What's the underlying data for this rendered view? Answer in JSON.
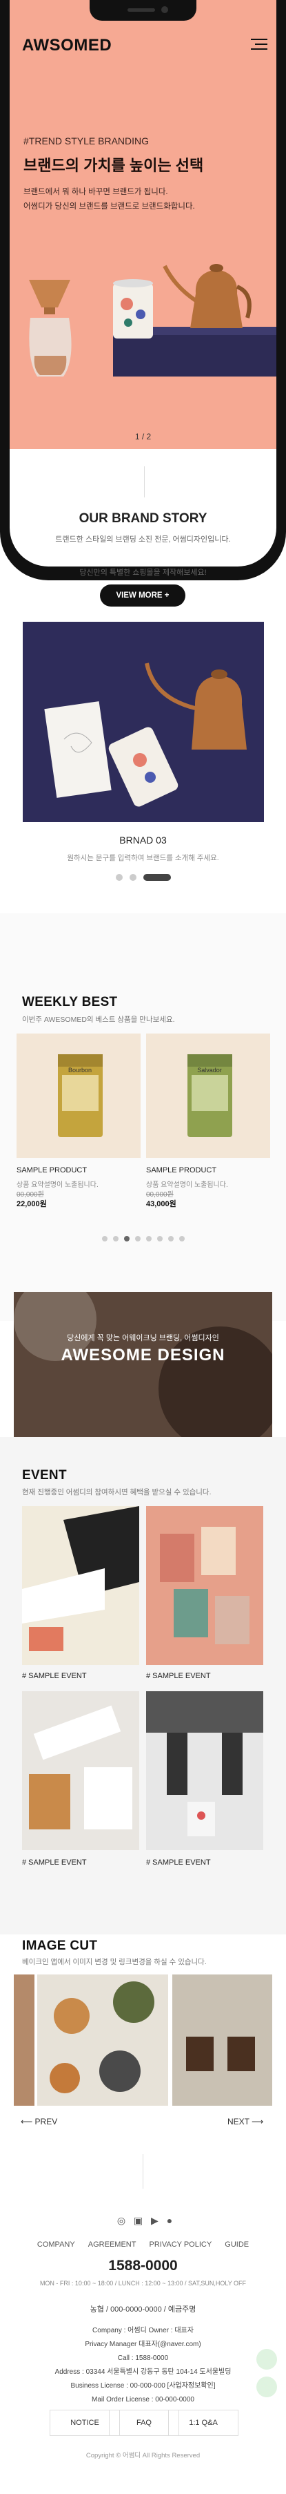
{
  "header": {
    "logo": "AWSOMED"
  },
  "hero": {
    "tag": "#TREND STYLE BRANDING",
    "title": "브랜드의 가치를 높이는 선택",
    "desc1": "브랜드에서 뭐 하나 바꾸면 브랜드가 됩니다.",
    "desc2": "어썸디가 당신의 브랜드를 브랜드로 브랜드화합니다.",
    "pager": "1 / 2"
  },
  "brand_story": {
    "title": "OUR BRAND STORY",
    "line1": "트랜드한 스타일의 브랜딩 소진 전문, 어썸디자인입니다.",
    "line2": "당신만의 특별한 쇼핑몰을 제작해보세요!",
    "button": "VIEW MORE +",
    "slide_title": "BRNAD 03",
    "slide_desc": "원하시는 문구를 입력하여 브랜드를 소개해 주세요."
  },
  "weekly_best": {
    "title": "WEEKLY BEST",
    "subtitle": "이번주 AWESOMED의 베스트 상품을 만나보세요.",
    "products": [
      {
        "name": "SAMPLE PRODUCT",
        "desc": "상품 요약설명이 노출됩니다.",
        "old_price": "00,000원",
        "price": "22,000원",
        "pkg": "Bourbon"
      },
      {
        "name": "SAMPLE PRODUCT",
        "desc": "상품 요약설명이 노출됩니다.",
        "old_price": "00,000원",
        "price": "43,000원",
        "pkg": "Salvador"
      }
    ]
  },
  "banner": {
    "small": "당신에게 꼭 맞는 어웨이크닝 브랜딩, 어썸디자인",
    "big": "AWESOME DESIGN"
  },
  "event": {
    "title": "EVENT",
    "subtitle": "현재 진행중인 어썸디의 참여하시면 혜택을 받으실 수 있습니다.",
    "items": [
      "# SAMPLE EVENT",
      "# SAMPLE EVENT",
      "# SAMPLE EVENT",
      "# SAMPLE EVENT"
    ]
  },
  "image_cut": {
    "title": "IMAGE CUT",
    "subtitle": "베이크인 앱에서 이미지 변경 및 링크변경을 하실 수 있습니다.",
    "prev": "PREV",
    "next": "NEXT"
  },
  "footer": {
    "menu": [
      "COMPANY",
      "AGREEMENT",
      "PRIVACY POLICY",
      "GUIDE"
    ],
    "phone": "1588-0000",
    "hours": "MON - FRI : 10:00 ~ 18:00 / LUNCH : 12:00 ~ 13:00 / SAT,SUN,HOLY OFF",
    "bank": "농협 / 000-0000-0000 / 예금주명",
    "company": "Company : 어썸디    Owner : 대표자",
    "privacy": "Privacy Manager 대표자(@naver.com)",
    "call": "Call : 1588-0000",
    "address": "Address : 03344 서울특별시 강동구 동탄 104-14 도서울빌딩",
    "license": "Business License : 00-000-000 [사업자정보확인]",
    "mail": "Mail Order License : 00-000-0000",
    "buttons": [
      "NOTICE",
      "FAQ",
      "1:1 Q&A"
    ],
    "copyright": "Copyright © 어썸디 All Rights Reserved"
  },
  "colors": {
    "hero_bg": "#f6a993",
    "navy": "#2d2b55",
    "dark": "#111111"
  }
}
